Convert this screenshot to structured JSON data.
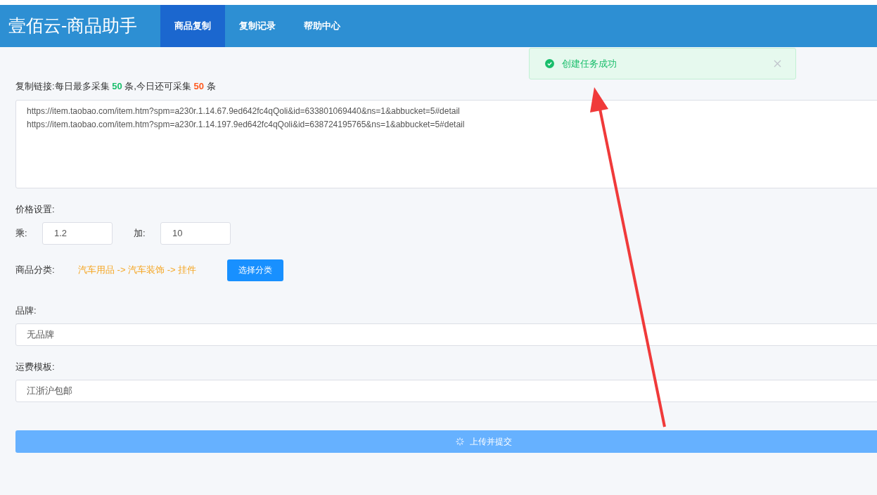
{
  "header": {
    "title": "壹佰云-商品助手",
    "tabs": [
      {
        "label": "商品复制",
        "selected": true
      },
      {
        "label": "复制记录",
        "selected": false
      },
      {
        "label": "帮助中心",
        "selected": false
      }
    ]
  },
  "notification": {
    "kind": "success",
    "message": "创建任务成功"
  },
  "form": {
    "links_label": "复制链接:每日最多采集 **50** 条,今日还可采集 **50** 条",
    "links": [
      "https://item.taobao.com/item.htm?spm=a230r.1.14.67.9ed642fc4qQoli&id=633801069440&ns=1&abbucket=5#detail",
      "https://item.taobao.com/item.htm?spm=a230r.1.14.197.9ed642fc4qQoli&id=638724195765&ns=1&abbucket=5#detail"
    ],
    "price_label": "价格设置:",
    "multiply_label": "乘:",
    "multiply_value": "1.2",
    "add_label": "加:",
    "add_value": "10",
    "category_label": "商品分类:",
    "category_path": "汽车用品 -> 汽车装饰 -> 挂件",
    "category_button": "选择分类",
    "brand_label": "品牌:",
    "brand_value": "无品牌",
    "shipping_label": "运费模板:",
    "shipping_value": "江浙沪包邮",
    "submit": {
      "label": "上传并提交",
      "loading": true
    }
  },
  "annotation": {
    "kind": "arrow",
    "color": "#f03a3a"
  }
}
